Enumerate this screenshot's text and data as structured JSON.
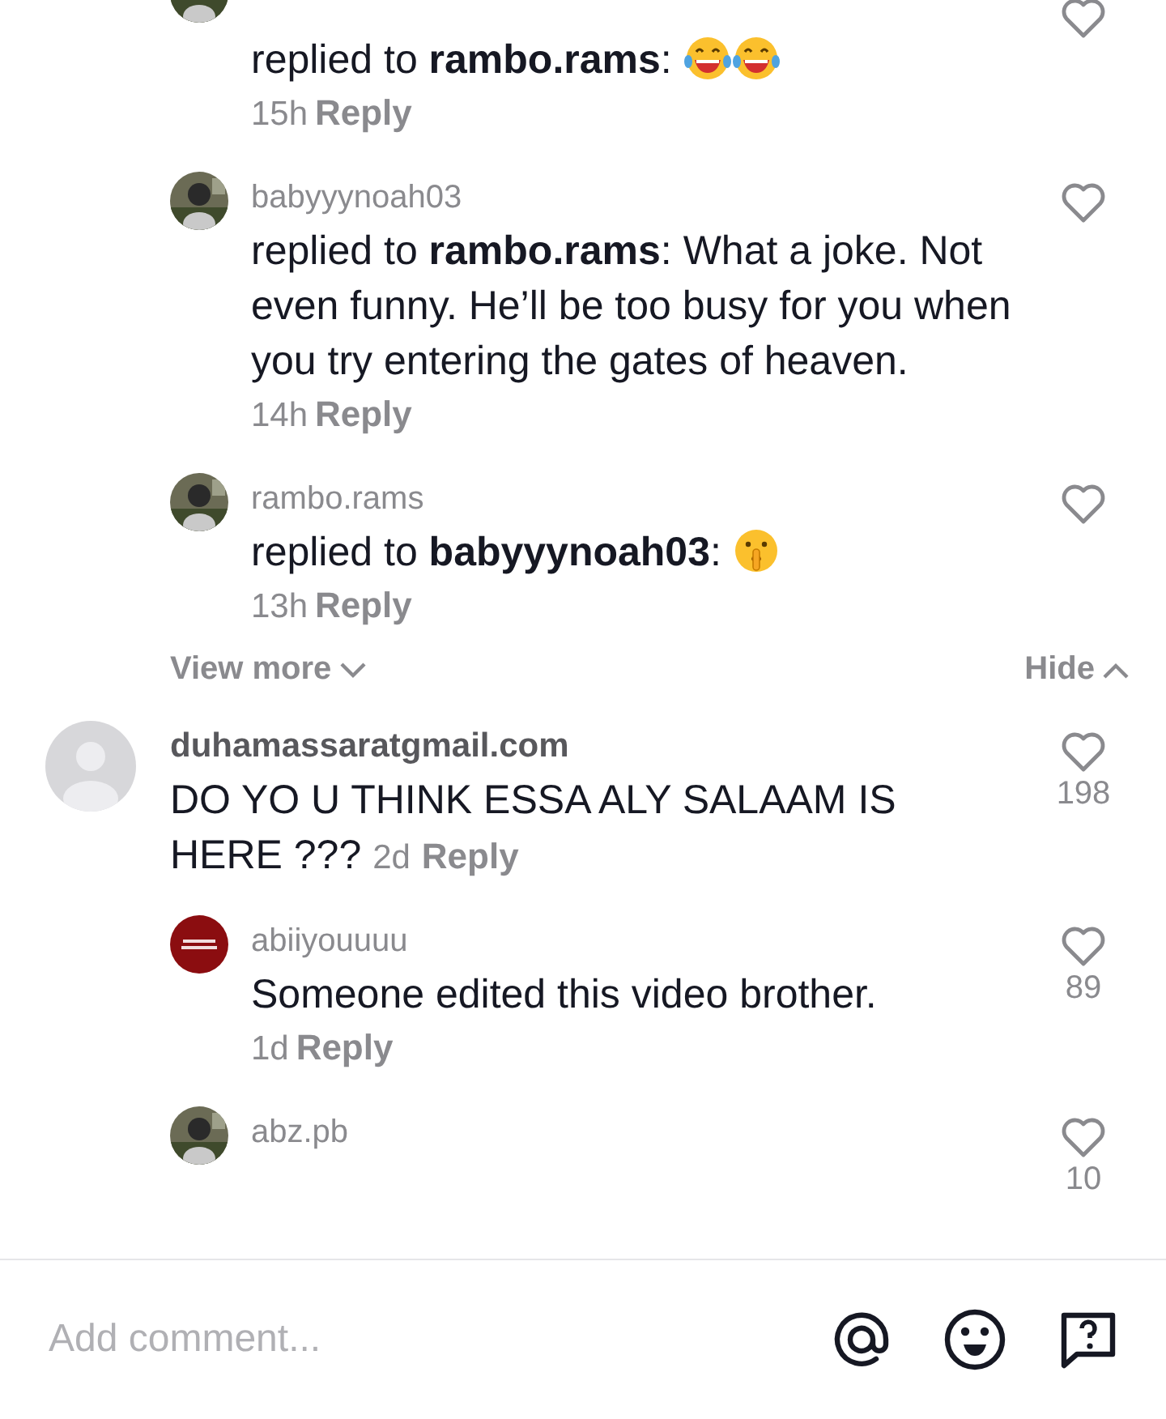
{
  "earlier_replies": [
    {
      "avatar": {
        "kind": "picture"
      },
      "text": "replied to **rambo.rams**: ",
      "emojis": [
        {
          "kind": "tears-of-joy"
        },
        {
          "kind": "tears-of-joy"
        }
      ],
      "time": "15h",
      "reply": "Reply",
      "liked": false
    },
    {
      "avatar": {
        "kind": "picture"
      },
      "user": "babyyynoah03",
      "text": "replied to **rambo.rams**: What a joke. Not even funny. He’ll be too busy for you when you try entering the gates of heaven.",
      "time": "14h",
      "reply": "Reply",
      "liked": false
    },
    {
      "avatar": {
        "kind": "picture"
      },
      "user": "rambo.rams",
      "text": "replied to **babyyynoah03**: ",
      "emojis": [
        {
          "kind": "shushing"
        }
      ],
      "time": "13h",
      "reply": "Reply",
      "liked": false
    }
  ],
  "thread_controls": {
    "view_more": "View more",
    "hide": "Hide"
  },
  "comments": [
    {
      "avatar": {
        "kind": "default"
      },
      "user": "duhamassaratgmail.com",
      "text": "DO YO U THINK ESSA ALY SALAAM IS HERE ???",
      "time": "2d",
      "reply": "Reply",
      "likes": "198",
      "liked": false,
      "replies": [
        {
          "avatar": {
            "kind": "badge"
          },
          "user": "abiiyouuuu",
          "text": "Someone edited this video brother.",
          "time": "1d",
          "reply": "Reply",
          "likes": "89",
          "liked": false
        },
        {
          "avatar": {
            "kind": "picture"
          },
          "user": "abz.pb",
          "likes": "10",
          "liked": false
        }
      ]
    }
  ],
  "composer": {
    "placeholder": "Add comment..."
  }
}
